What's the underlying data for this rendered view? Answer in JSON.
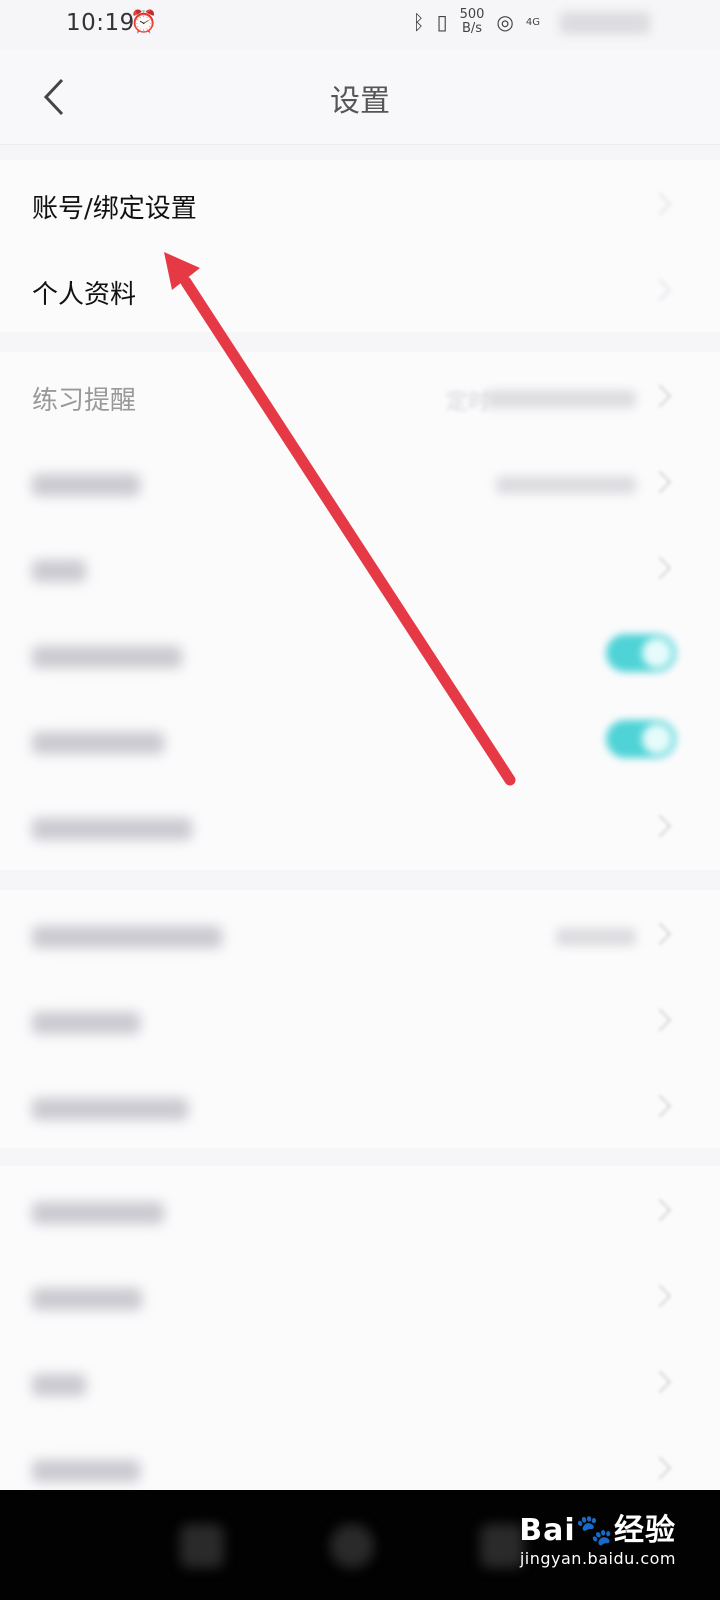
{
  "status_bar": {
    "time": "10:19",
    "net_speed_top": "500",
    "net_speed_bottom": "B/s",
    "signal_label": "4G"
  },
  "header": {
    "title": "设置"
  },
  "settings": {
    "account_binding": "账号/绑定设置",
    "profile": "个人资料",
    "practice_reminder": "练习提醒",
    "practice_reminder_value": "定时"
  },
  "watermark": {
    "brand": "Bai",
    "brand_cn": "经验",
    "url": "jingyan.baidu.com"
  },
  "colors": {
    "toggle_on": "#4fd3d6",
    "arrow": "#e63946"
  }
}
